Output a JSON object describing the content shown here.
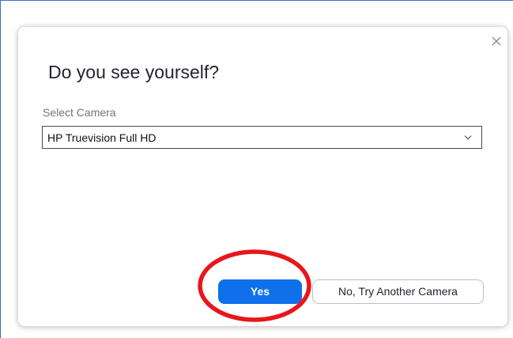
{
  "dialog": {
    "title": "Do you see yourself?",
    "camera_label": "Select Camera",
    "camera_selected": "HP Truevision Full HD",
    "close_icon": "close-icon",
    "dropdown_icon": "chevron-down-icon"
  },
  "buttons": {
    "yes_label": "Yes",
    "no_label": "No, Try Another Camera"
  },
  "colors": {
    "primary": "#0e71eb",
    "annotation": "#e8161b",
    "frame_border": "#3b6fc4"
  }
}
